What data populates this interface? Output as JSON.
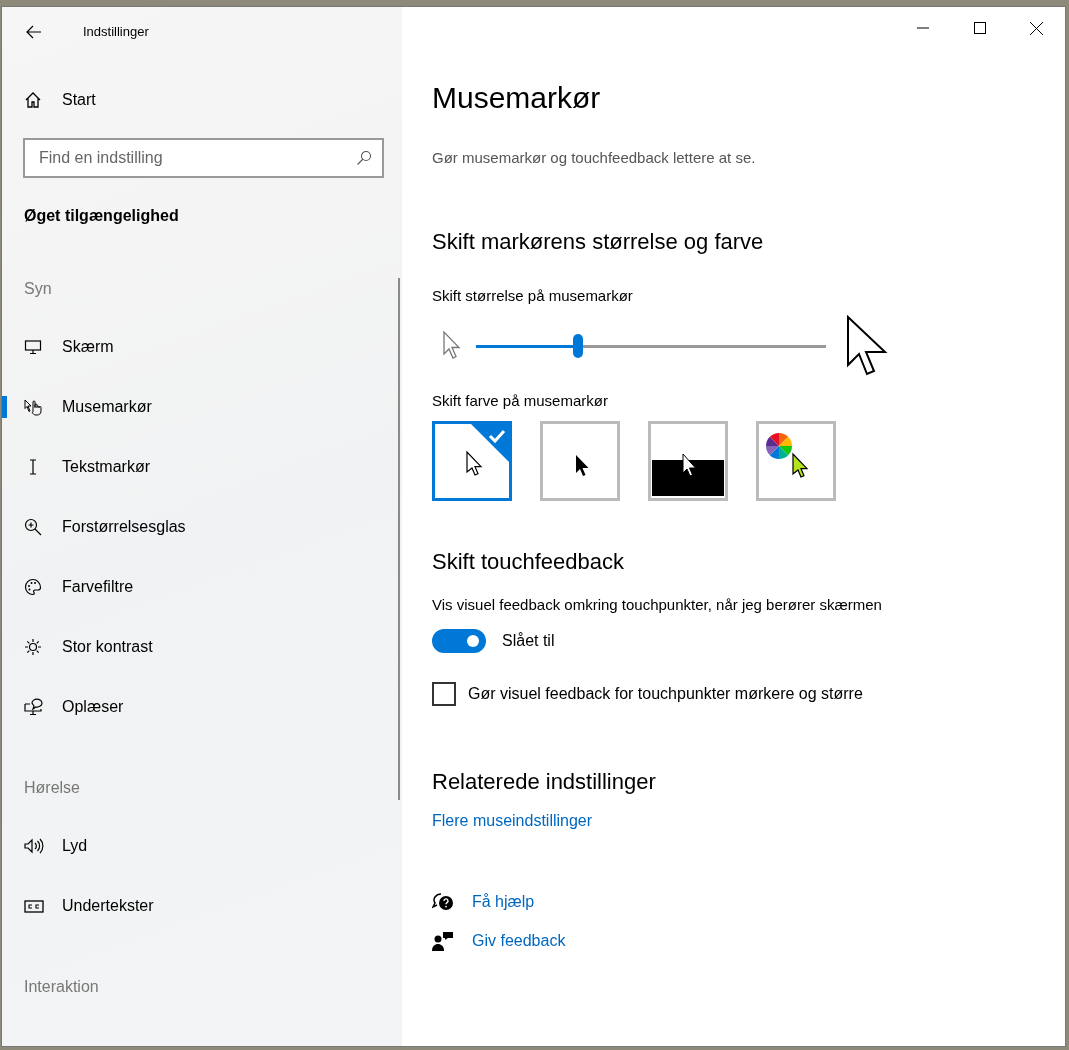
{
  "window": {
    "title": "Indstillinger"
  },
  "nav": {
    "start": {
      "label": "Start"
    },
    "search": {
      "placeholder": "Find en indstilling"
    },
    "category": "Øget tilgængelighed",
    "groups": [
      {
        "heading": "Syn",
        "items": [
          {
            "label": "Skærm",
            "selected": false
          },
          {
            "label": "Musemarkør",
            "selected": true
          },
          {
            "label": "Tekstmarkør",
            "selected": false
          },
          {
            "label": "Forstørrelsesglas",
            "selected": false
          },
          {
            "label": "Farvefiltre",
            "selected": false
          },
          {
            "label": "Stor kontrast",
            "selected": false
          },
          {
            "label": "Oplæser",
            "selected": false
          }
        ]
      },
      {
        "heading": "Hørelse",
        "items": [
          {
            "label": "Lyd",
            "selected": false
          },
          {
            "label": "Undertekster",
            "selected": false
          }
        ]
      },
      {
        "heading": "Interaktion"
      }
    ]
  },
  "page": {
    "title": "Musemarkør",
    "description": "Gør musemarkør og touchfeedback lettere at se.",
    "size_section": {
      "heading": "Skift markørens størrelse og farve",
      "size_label": "Skift størrelse på musemarkør",
      "size_slider": {
        "level": 0.29
      },
      "color_label": "Skift farve på musemarkør",
      "color_options": [
        {
          "kind": "white",
          "selected": true
        },
        {
          "kind": "black",
          "selected": false
        },
        {
          "kind": "inverted",
          "selected": false
        },
        {
          "kind": "custom",
          "selected": false
        }
      ]
    },
    "touch_section": {
      "heading": "Skift touchfeedback",
      "label": "Vis visuel feedback omkring touchpunkter, når jeg berører skærmen",
      "toggle": {
        "on": true,
        "label": "Slået til"
      },
      "checkbox": {
        "checked": false,
        "label": "Gør visuel feedback for touchpunkter mørkere og større"
      }
    },
    "related": {
      "heading": "Relaterede indstillinger",
      "link": "Flere museindstillinger"
    },
    "help_links": [
      {
        "label": "Få hjælp"
      },
      {
        "label": "Giv feedback"
      }
    ]
  }
}
